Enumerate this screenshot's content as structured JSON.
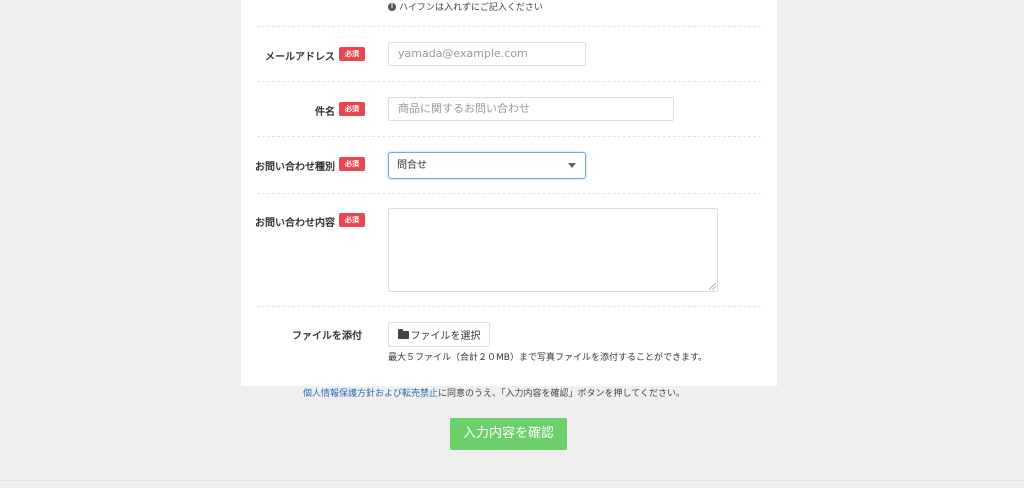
{
  "form": {
    "hyphen_note": "ハイフンは入れずにご記入ください",
    "required_badge": "必須",
    "email": {
      "label": "メールアドレス",
      "placeholder": "yamada@example.com"
    },
    "subject": {
      "label": "件名",
      "placeholder": "商品に関するお問い合わせ"
    },
    "inquiry_type": {
      "label": "お問い合わせ種別",
      "selected": "問合せ"
    },
    "inquiry_body": {
      "label": "お問い合わせ内容"
    },
    "attachment": {
      "label": "ファイルを添付",
      "button_label": "ファイルを選択",
      "note": "最大５ファイル（合計２０MB）まで写真ファイルを添付することができます。"
    }
  },
  "consent": {
    "link_text": "個人情報保護方針および転売禁止",
    "text": "に同意のうえ、「入力内容を確認」ボタンを押してください。"
  },
  "submit_label": "入力内容を確認",
  "colors": {
    "badge": "#e8474f",
    "submit": "#6ccf6c",
    "link": "#2a6fb8",
    "focus_border": "#6aaee0"
  }
}
